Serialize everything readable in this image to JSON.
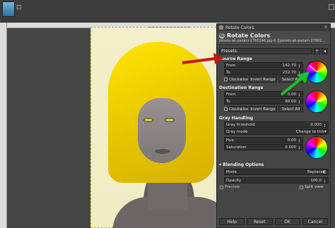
{
  "dialog": {
    "window_title": "Rotate Colors",
    "heading": "Rotate Colors",
    "subtitle": "pexels-ali-pazani-2760246.jpg-6 ([pexels-ali-pazani-27602...",
    "presets_label": "Presets:",
    "source_range": {
      "title": "Source Range",
      "from_label": "From",
      "from_value": "142.70",
      "to_label": "To",
      "to_value": "232.70",
      "clockwise_label": "Clockwise",
      "invert_label": "Invert Range",
      "select_all_label": "Select All"
    },
    "destination_range": {
      "title": "Destination Range",
      "from_label": "From",
      "from_value": "0.00",
      "to_label": "To",
      "to_value": "90.00",
      "clockwise_label": "Clockwise",
      "invert_label": "Invert Range",
      "select_all_label": "Select All"
    },
    "gray_handling": {
      "title": "Gray Handling",
      "threshold_label": "Gray threshold",
      "threshold_value": "0.000",
      "mode_label": "Gray mode",
      "mode_value": "Change to this",
      "hue_label": "Hue",
      "hue_value": "0.00",
      "saturation_label": "Saturation",
      "saturation_value": "0.000"
    },
    "blending": {
      "title": "Blending Options",
      "mode_label": "Mode",
      "mode_value": "Replace",
      "opacity_label": "Opacity",
      "opacity_value": "100.0"
    },
    "preview_label": "Preview",
    "split_view_label": "Split view",
    "buttons": {
      "help": "Help",
      "reset": "Reset",
      "ok": "OK",
      "cancel": "Cancel"
    }
  },
  "colors": {
    "arrow_red": "#c81414",
    "arrow_green": "#18c22a"
  }
}
